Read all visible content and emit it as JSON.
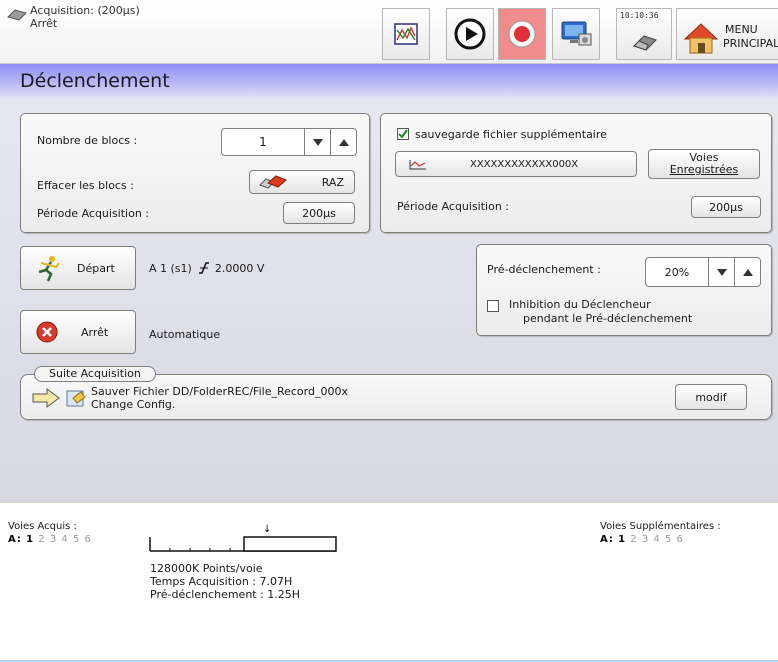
{
  "topbar": {
    "status_line1": "Acquisition: (200µs)",
    "status_line2": "Arrêt",
    "clock_time": "10:10:36",
    "menu_line1": "MENU",
    "menu_line2": "PRINCIPAL",
    "icons": [
      "chart-window-icon",
      "play-icon",
      "record-icon",
      "monitor-icon",
      "eraser-icon",
      "home-icon"
    ],
    "record_color": "#e0303a",
    "accent": "#8d8df5"
  },
  "page": {
    "title": "Déclenchement"
  },
  "blocks_panel": {
    "nombre_label": "Nombre de blocs :",
    "nombre_value": "1",
    "effacer_label": "Effacer les blocs :",
    "raz_label": "RAZ",
    "periode_label": "Période Acquisition :",
    "periode_value": "200µs"
  },
  "save_panel": {
    "checkbox_label": "sauvegarde fichier supplémentaire",
    "checked": true,
    "file_name": "XXXXXXXXXXXX000X",
    "voies_line1": "Voies",
    "voies_line2": "Enregistrées",
    "periode_label": "Période Acquisition :",
    "periode_value": "200µs"
  },
  "trigger": {
    "depart_label": "Départ",
    "depart_desc": "A 1  (s1)",
    "depart_value": "2.0000 V",
    "arret_label": "Arrêt",
    "arret_desc": "Automatique"
  },
  "pretrigger": {
    "label": "Pré-déclenchement :",
    "value": "20%",
    "inhibit_line1": "Inhibition du Déclencheur",
    "inhibit_line2": "pendant le Pré-déclenchement",
    "inhibit_checked": false
  },
  "suite": {
    "legend": "Suite Acquisition",
    "line1": "Sauver Fichier DD/FolderREC/File_Record_000x",
    "line2": "Change Config.",
    "modif_label": "modif"
  },
  "bottom": {
    "voies_acquis_label": "Voies Acquis :",
    "voies_acquis_prefix": "A:",
    "voies_supp_label": "Voies Supplémentaires :",
    "voies_supp_prefix": "A:",
    "channels": [
      "1",
      "2",
      "3",
      "4",
      "5",
      "6"
    ],
    "points": "128000K Points/voie",
    "temps": "Temps Acquisition : 7.07H",
    "pre": "Pré-déclenchement :  1.25H",
    "marker": "↓",
    "pretrigger_fraction": 0.2
  }
}
